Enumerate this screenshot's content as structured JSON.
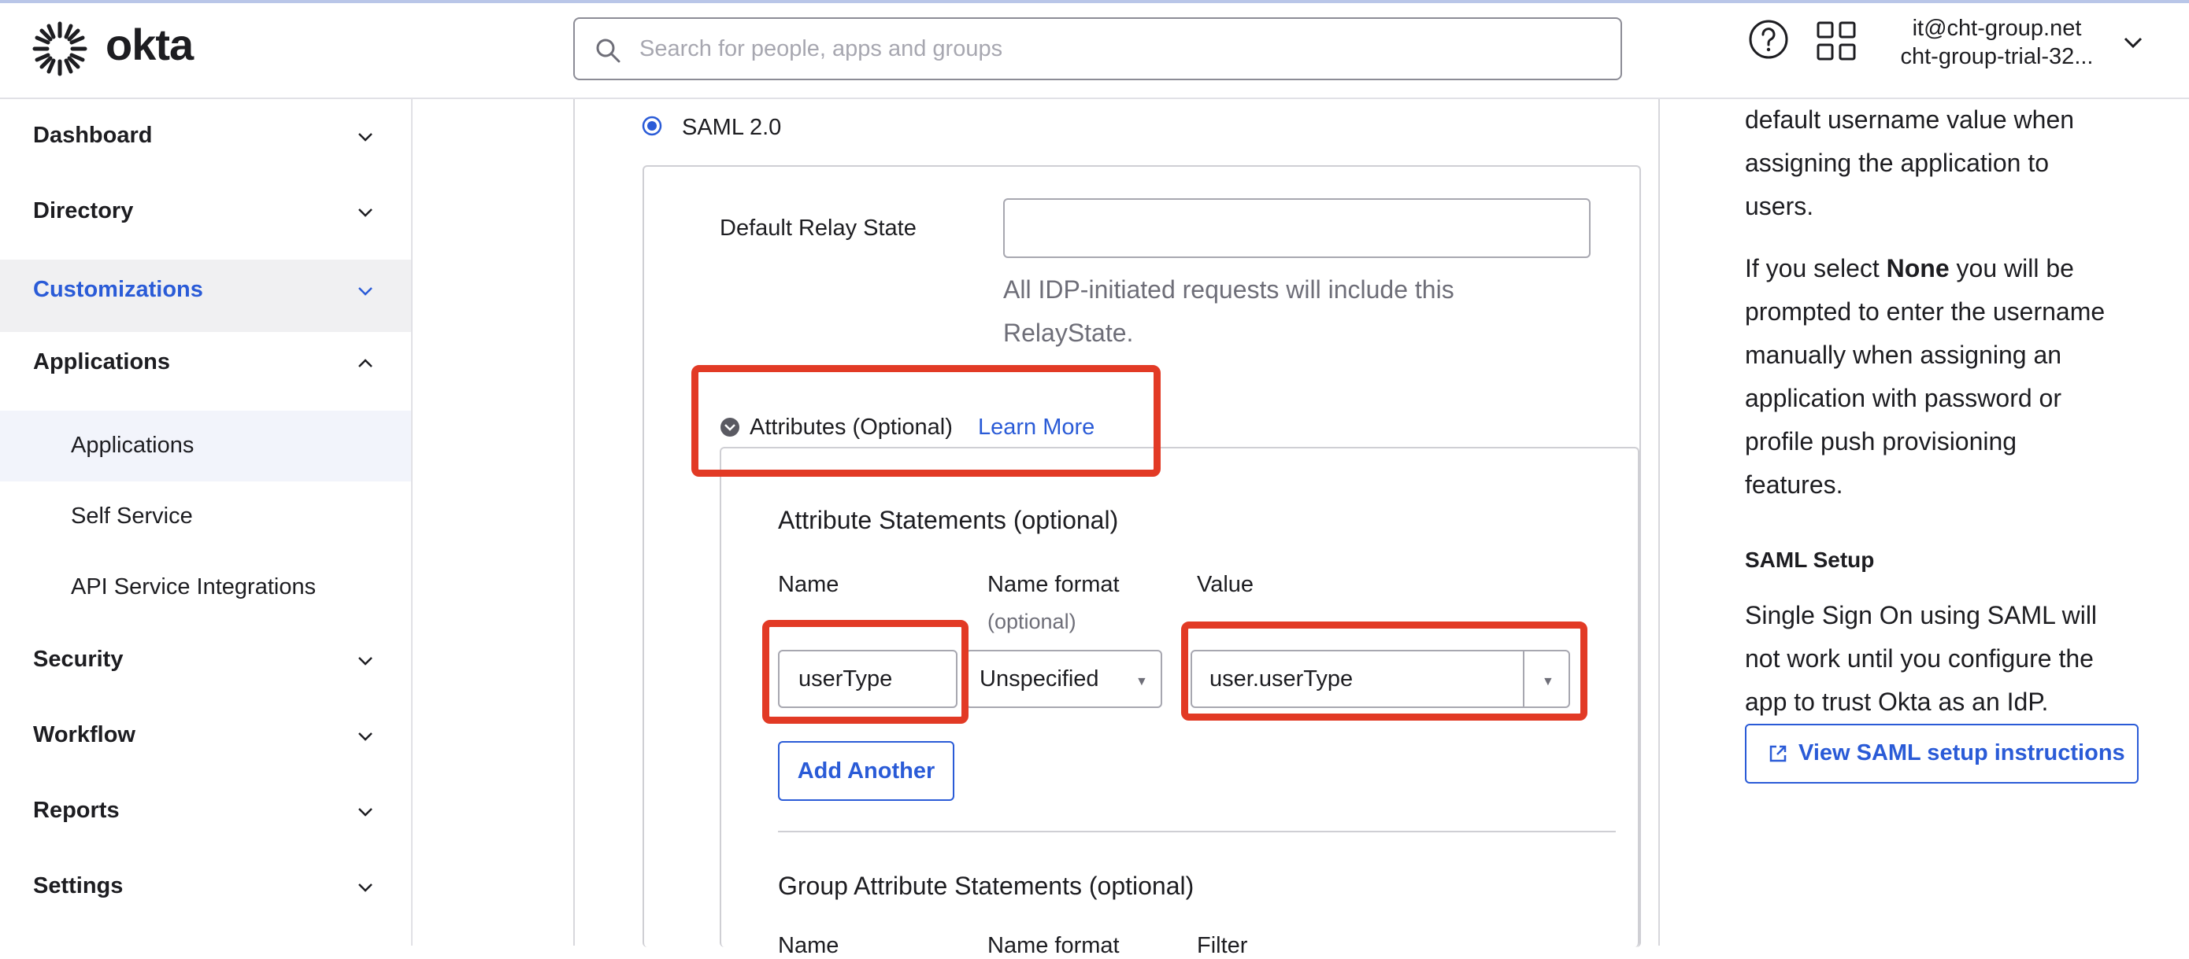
{
  "header": {
    "logo_text": "okta",
    "search_placeholder": "Search for people, apps and groups",
    "user_email": "it@cht-group.net",
    "user_org": "cht-group-trial-32..."
  },
  "sidebar": {
    "items": [
      {
        "label": "Dashboard"
      },
      {
        "label": "Directory"
      },
      {
        "label": "Customizations"
      },
      {
        "label": "Applications"
      },
      {
        "label": "Security"
      },
      {
        "label": "Workflow"
      },
      {
        "label": "Reports"
      },
      {
        "label": "Settings"
      }
    ],
    "applications_sub": [
      {
        "label": "Applications"
      },
      {
        "label": "Self Service"
      },
      {
        "label": "API Service Integrations"
      }
    ]
  },
  "main": {
    "saml_option": "SAML 2.0",
    "relay_state_label": "Default Relay State",
    "relay_state_value": "",
    "relay_help_line1": "All IDP-initiated requests will include this",
    "relay_help_line2": "RelayState.",
    "attributes_label": "Attributes (Optional)",
    "learn_more": "Learn More",
    "attribute_statements_title": "Attribute Statements (optional)",
    "col_name": "Name",
    "col_name_format": "Name format",
    "col_name_format_optional": "(optional)",
    "col_value": "Value",
    "row": {
      "name": "userType",
      "name_format": "Unspecified",
      "value": "user.userType"
    },
    "add_another": "Add Another",
    "group_attribute_statements_title": "Group Attribute Statements (optional)",
    "group_col_name": "Name",
    "group_col_name_format": "Name format",
    "group_col_filter": "Filter"
  },
  "right_panel": {
    "lines": [
      "default username value when",
      "assigning the application to",
      "users."
    ],
    "none_para_pre": "If you select ",
    "none_para_bold": "None",
    "none_para_post": " you will be",
    "none_lines": [
      "prompted to enter the username",
      "manually when assigning an",
      "application with password or",
      "profile push provisioning",
      "features."
    ],
    "saml_setup_title": "SAML Setup",
    "saml_lines": [
      "Single Sign On using SAML will",
      "not work until you configure the",
      "app to trust Okta as an IdP."
    ],
    "view_saml_button": "View SAML setup instructions"
  },
  "colors": {
    "accent": "#2a5bd7",
    "highlight": "#e23a25",
    "sidebar_active_bg": "#f0f0f2"
  },
  "icons": [
    "okta-logo-icon",
    "search-icon",
    "help-icon",
    "app-grid-icon",
    "chevron-down-icon",
    "chevron-up-icon",
    "radio-selected-icon",
    "collapse-toggle-icon",
    "caret-down-icon",
    "external-link-icon"
  ]
}
